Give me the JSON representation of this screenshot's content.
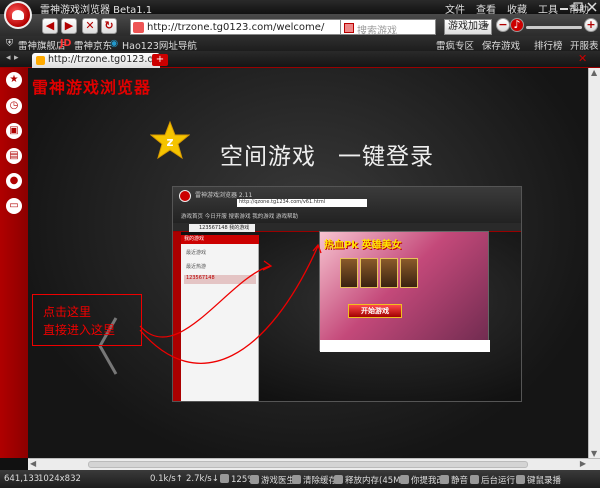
{
  "window": {
    "title": "雷神游戏浏览器 Beta1.1",
    "menu": [
      "文件",
      "查看",
      "收藏",
      "工具",
      "帮助"
    ]
  },
  "toolbar": {
    "back": "◀",
    "forward": "▶",
    "stop": "✕",
    "refresh": "↻",
    "url": "http://trzone.tg0123.com/welcome/",
    "search_placeholder": "搜索游戏",
    "game_accel": "游戏加速"
  },
  "bookmarks": {
    "items": [
      "雷神旗舰店",
      "雷神京东",
      "Hao123网址导航"
    ],
    "right_items": [
      "雷疯专区",
      "保存游戏",
      "排行榜",
      "开服表"
    ]
  },
  "tabs": {
    "active_label": "http://trzone.tg0123.c...",
    "new_tab": "+"
  },
  "sidebar": {
    "icons": [
      "star-icon",
      "clock-icon",
      "gamepad-icon",
      "briefcase-icon",
      "user-icon",
      "chat-icon"
    ]
  },
  "content": {
    "brand": "雷神游戏浏览器",
    "headline_part1": "空间游戏",
    "headline_part2": "一键登录",
    "callout_line1": "点击这里",
    "callout_line2": "直接进入这里",
    "inner": {
      "title": "雷神游戏浏览器 2.11",
      "address": "http://qzone.tg1234.com/v61.html",
      "nav": "游戏首页   今日开服   搜索游戏   我的游戏   游戏帮助",
      "tab": "123567148  我的游戏",
      "panel_head": "我的游戏",
      "panel_rows": [
        "最近游戏",
        "最近热游",
        "123567148"
      ],
      "game_title": "热血Pk  英雄美女",
      "start_button": "开始游戏"
    }
  },
  "status": {
    "coords": "641,133",
    "resolution": "1024x832",
    "download": "0.1k/s↑",
    "upload": "2.7k/s↓",
    "zoom": "125%",
    "tools": [
      "游戏医生",
      "清除缓存",
      "释放内存(45M)",
      "你提我改",
      "静音",
      "后台运行",
      "键鼠录播"
    ]
  },
  "colors": {
    "brand_red": "#b00000",
    "accent_red": "#e00000"
  }
}
